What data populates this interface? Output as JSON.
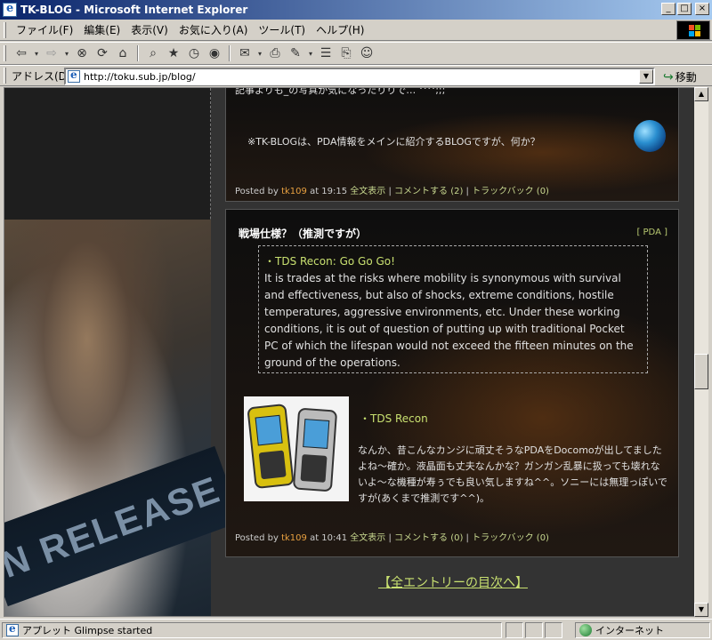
{
  "window": {
    "title": "TK-BLOG - Microsoft Internet Explorer",
    "minimize": "_",
    "maximize": "□",
    "close": "×"
  },
  "menu": {
    "items": [
      "ファイル(F)",
      "編集(E)",
      "表示(V)",
      "お気に入り(A)",
      "ツール(T)",
      "ヘルプ(H)"
    ]
  },
  "toolbar": {
    "icons": [
      "back-icon",
      "forward-icon",
      "stop-icon",
      "refresh-icon",
      "home-icon",
      "search-icon",
      "favorites-icon",
      "history-icon",
      "mail-icon",
      "print-icon",
      "edit-icon",
      "discuss-icon",
      "messenger-icon"
    ]
  },
  "address": {
    "label": "アドレス(D)",
    "url": "http://toku.sub.jp/blog/",
    "go_label": "移動"
  },
  "post1": {
    "partial_text": "記事よりも_の写真が気になったりりで… ^^;;;",
    "text": "※TK-BLOGは、PDA情報をメインに紹介するBLOGですが、何か？",
    "footer_prefix": "Posted by",
    "author": "tk109",
    "time": "at 19:15",
    "full_text": "全文表示",
    "comments": "コメントする (2)",
    "trackback": "トラックバック (0)"
  },
  "post2": {
    "title": "戦場仕様？（推測ですが）",
    "category": "[ PDA ]",
    "quote_link": "・TDS Recon: Go Go Go!",
    "quote_text": "It is trades at the risks where mobility is synonymous with survival and effectiveness, but also of shocks, extreme conditions, hostile temperatures, aggressive environments, etc. Under these working conditions, it is out of question of putting up with traditional Pocket PC of which the lifespan would not exceed the fifteen minutes on the ground of the operations.",
    "product_link": "・TDS Recon",
    "text": "なんか、昔こんなカンジに頑丈そうなPDAをDocomoが出してましたよね～確か。液晶面も丈夫なんかな？ガンガン乱暴に扱っても壊れないよ～な機種が寿ぅでも良い気しますね^^。ソニーには無理っぽいですが(あくまで推測です^^)。",
    "footer_prefix": "Posted by",
    "author": "tk109",
    "time": "at 10:41",
    "full_text": "全文表示",
    "comments": "コメントする (0)",
    "trackback": "トラックバック (0)"
  },
  "toc_link": "【全エントリーの目次へ】",
  "left_image": {
    "sign_text": "N RELEASE"
  },
  "status": {
    "message": "アプレット Glimpse started",
    "zone": "インターネット"
  }
}
